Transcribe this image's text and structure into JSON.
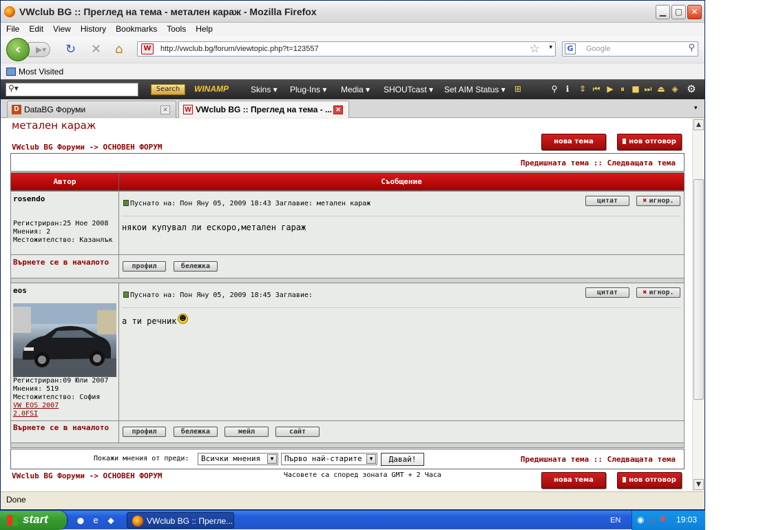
{
  "window": {
    "title": "VWclub BG :: Преглед на тема - метален караж - Mozilla Firefox"
  },
  "menu": [
    "File",
    "Edit",
    "View",
    "History",
    "Bookmarks",
    "Tools",
    "Help"
  ],
  "nav": {
    "url": "http://vwclub.bg/forum/viewtopic.php?t=123557",
    "search_placeholder": "Google"
  },
  "bookmarks": {
    "most_visited": "Most Visited"
  },
  "winamp": {
    "search_label": "Search",
    "logo": "WINAMP",
    "items": [
      "Skins",
      "Plug-Ins",
      "Media",
      "SHOUTcast",
      "Set AIM Status"
    ]
  },
  "tabs": [
    {
      "label": "DataBG Форуми",
      "icon": "D"
    },
    {
      "label": "VWclub BG :: Преглед на тема - ...",
      "icon": "W"
    }
  ],
  "forum": {
    "topic_title": "метален караж",
    "breadcrumb": "VWclub BG Форуми -> ОСНОВЕН ФОРУМ",
    "new_topic": "нова тема",
    "new_reply": "нов отговор",
    "nav_links": "Предишната тема :: Следващата тема",
    "col_author": "Автор",
    "col_message": "Съобщение",
    "back_to_top": "Върнете се в началото",
    "posts": [
      {
        "author": "rosendo",
        "registered": "Регистриран:25 Ное 2008",
        "posts_count": "Мнения: 2",
        "location": "Местожителство: Казанлък",
        "meta": "Пуснато на: Пон Яну 05, 2009 18:43   Заглавие: метален караж",
        "message": "някои купувал ли ескоро,метален гараж",
        "quote": "цитат",
        "ignore": "игнор.",
        "buttons": [
          "профил",
          "бележка"
        ]
      },
      {
        "author": "eos",
        "registered": "Регистриран:09 Юли 2007",
        "posts_count": "Мнения: 519",
        "location": "Местожителство: София",
        "car_link_1": "VW EOS 2007",
        "car_link_2": "2.0FSI",
        "meta": "Пуснато на: Пон Яну 05, 2009 18:45   Заглавие:",
        "message": "а ти речник",
        "quote": "цитат",
        "ignore": "игнор.",
        "buttons": [
          "профил",
          "бележка",
          "мейл",
          "сайт"
        ]
      }
    ],
    "show_posts_from": "Покажи мнения от преди:",
    "filter_all": "Всички мнения",
    "filter_order": "Първо най-старите",
    "go": "Давай!",
    "timezone": "Часовете са според зоната GMT + 2 Часа"
  },
  "status": "Done",
  "taskbar": {
    "start": "start",
    "task": "VWclub BG :: Прегле...",
    "lang": "EN",
    "clock": "19:03"
  }
}
